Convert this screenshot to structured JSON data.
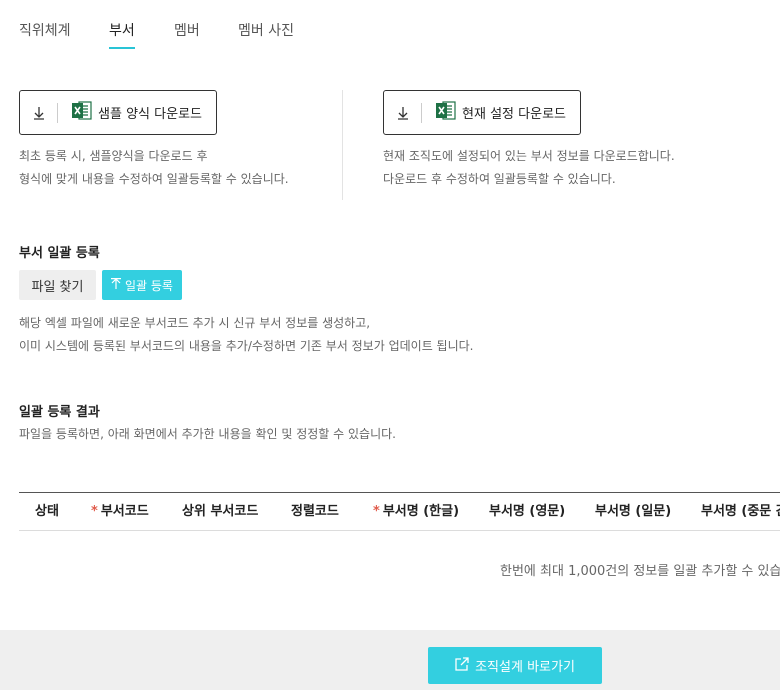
{
  "tabs": [
    {
      "label": "직위체계",
      "active": false
    },
    {
      "label": "부서",
      "active": true
    },
    {
      "label": "멤버",
      "active": false
    },
    {
      "label": "멤버 사진",
      "active": false
    }
  ],
  "downloads": {
    "sample": {
      "label": "샘플 양식 다운로드",
      "desc_line1": "최초 등록 시, 샘플양식을 다운로드 후",
      "desc_line2": "형식에 맞게 내용을 수정하여 일괄등록할 수 있습니다."
    },
    "current": {
      "label": "현재 설정 다운로드",
      "desc_line1": "현재 조직도에 설정되어 있는 부서 정보를 다운로드합니다.",
      "desc_line2": "다운로드 후 수정하여 일괄등록할 수 있습니다."
    }
  },
  "bulk_register": {
    "title": "부서 일괄 등록",
    "find_file_label": "파일 찾기",
    "upload_label": "일괄 등록",
    "desc_line1": "해당 엑셀 파일에 새로운 부서코드 추가 시 신규 부서 정보를 생성하고,",
    "desc_line2": "이미 시스템에 등록된 부서코드의 내용을 추가/수정하면 기존 부서 정보가 업데이트 됩니다."
  },
  "result": {
    "title": "일괄 등록 결과",
    "desc": "파일을 등록하면, 아래 화면에서 추가한 내용을 확인 및 정정할 수 있습니다.",
    "columns": [
      {
        "label": "상태",
        "required": false
      },
      {
        "label": "부서코드",
        "required": true
      },
      {
        "label": "상위 부서코드",
        "required": false
      },
      {
        "label": "정렬코드",
        "required": false
      },
      {
        "label": "부서명 (한글)",
        "required": true
      },
      {
        "label": "부서명 (영문)",
        "required": false
      },
      {
        "label": "부서명 (일문)",
        "required": false
      },
      {
        "label": "부서명 (중문 간",
        "required": false
      }
    ],
    "required_mark": "*",
    "limit_note": "한번에 최대 1,000건의 정보를 일괄 추가할 수 있습"
  },
  "footer": {
    "button_label": "조직설계 바로가기"
  },
  "icons": {
    "download": "download-arrow-icon",
    "excel": "excel-icon",
    "upload": "upload-arrow-icon",
    "external": "external-link-icon"
  },
  "colors": {
    "accent": "#33cfe0",
    "required": "#e05b4b",
    "excel": "#1e7145"
  }
}
